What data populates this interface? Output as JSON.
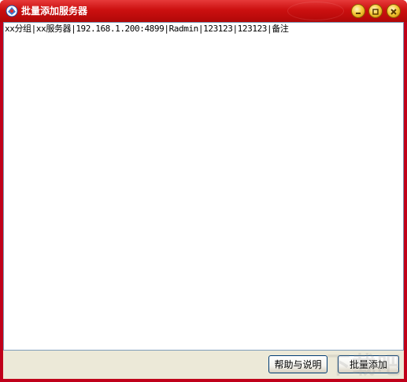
{
  "window": {
    "title": "批量添加服务器",
    "icons": {
      "app": "app-logo-icon",
      "minimize": "minimize-icon",
      "maximize": "maximize-icon",
      "close": "close-icon"
    }
  },
  "editor": {
    "content": "xx分组|xx服务器|192.168.1.200:4899|Radmin|123123|123123|备注"
  },
  "buttons": {
    "help_label": "帮助与说明",
    "add_label": "批量添加"
  },
  "watermark": {
    "text": "下载吧"
  },
  "colors": {
    "titlebar": "#cc1010",
    "window_bg": "#ece9d8",
    "button_border": "#003c74"
  }
}
